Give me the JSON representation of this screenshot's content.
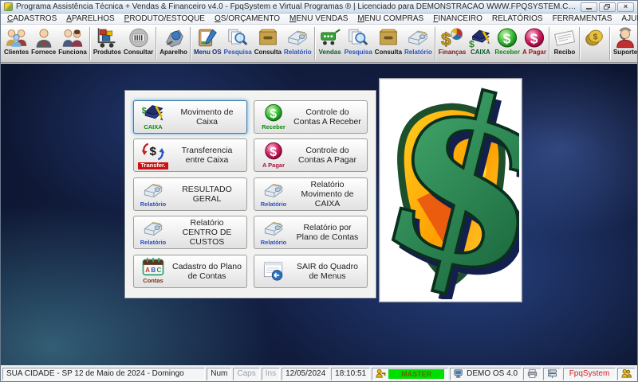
{
  "titlebar": {
    "title": "Programa Assistência Técnica + Vendas & Financeiro v4.0 - FpqSystem e Virtual Programas ® | Licenciado para DEMONSTRACAO WWW.FPQSYSTEM.COM.BR"
  },
  "menubar": {
    "items": [
      "CADASTROS",
      "APARELHOS",
      "PRODUTO/ESTOQUE",
      "OS/ORÇAMENTO",
      "MENU VENDAS",
      "MENU COMPRAS",
      "FINANCEIRO",
      "RELATÓRIOS",
      "FERRAMENTAS",
      "AJUDA"
    ]
  },
  "toolbar": {
    "items": [
      {
        "label": "Clientes",
        "icon": "clients-group-icon"
      },
      {
        "label": "Fornece",
        "icon": "supplier-icon"
      },
      {
        "label": "Funciona",
        "icon": "employees-icon"
      },
      {
        "label": "Produtos",
        "icon": "products-cart-icon"
      },
      {
        "label": "Consultar",
        "icon": "barcode-search-icon"
      },
      {
        "label": "Aparelho",
        "icon": "device-icon"
      },
      {
        "label": "Menu OS",
        "icon": "service-order-icon"
      },
      {
        "label": "Pesquisa",
        "icon": "search-docs-icon"
      },
      {
        "label": "Consulta",
        "icon": "drawer-folder-icon"
      },
      {
        "label": "Relatório",
        "icon": "printer-icon"
      },
      {
        "label": "Vendas",
        "icon": "sales-cart-icon"
      },
      {
        "label": "Pesquisa",
        "icon": "search-docs-icon"
      },
      {
        "label": "Consulta",
        "icon": "drawer-folder-icon"
      },
      {
        "label": "Relatório",
        "icon": "printer-icon"
      },
      {
        "label": "Finanças",
        "icon": "finance-pie-icon"
      },
      {
        "label": "CAIXA",
        "icon": "cash-book-icon"
      },
      {
        "label": "Receber",
        "icon": "receive-dollar-icon"
      },
      {
        "label": "A Pagar",
        "icon": "pay-dollar-icon"
      },
      {
        "label": "Recibo",
        "icon": "receipt-icon"
      },
      {
        "label": "",
        "icon": "coins-icon"
      },
      {
        "label": "Suporte",
        "icon": "support-icon"
      },
      {
        "label": "",
        "icon": "exit-door-icon"
      }
    ]
  },
  "menu_panel": {
    "buttons": [
      {
        "label": "Movimento de Caixa",
        "caption": "CAIXA"
      },
      {
        "label": "Controle do Contas A Receber",
        "caption": "Receber"
      },
      {
        "label": "Transferencia entre Caixa",
        "caption": "Transfer."
      },
      {
        "label": "Controle do Contas A Pagar",
        "caption": "A Pagar"
      },
      {
        "label": "RESULTADO GERAL",
        "caption": "Relatório"
      },
      {
        "label": "Relatório Movimento de CAIXA",
        "caption": "Relatório"
      },
      {
        "label": "Relatório CENTRO DE CUSTOS",
        "caption": "Relatório"
      },
      {
        "label": "Relatório por Plano de Contas",
        "caption": "Relatório"
      },
      {
        "label": "Cadastro do Plano de Contas",
        "caption": "Contas"
      },
      {
        "label": "SAIR do Quadro de Menus",
        "caption": ""
      }
    ]
  },
  "statusbar": {
    "location": "SUA CIDADE  - SP 12 de Maio de 2024 - Domingo",
    "num_lock": "Num",
    "caps_lock": "Caps",
    "insert": "Ins",
    "date": "12/05/2024",
    "time": "18:10:51",
    "user": "MASTER",
    "system": "DEMO OS 4.0",
    "brand": "FpqSystem"
  },
  "colors": {
    "master_badge_bg": "#00e000",
    "brand_red": "#cc2222",
    "focus_blue": "#3c7fb1",
    "desktop_base": "#070c1e"
  }
}
